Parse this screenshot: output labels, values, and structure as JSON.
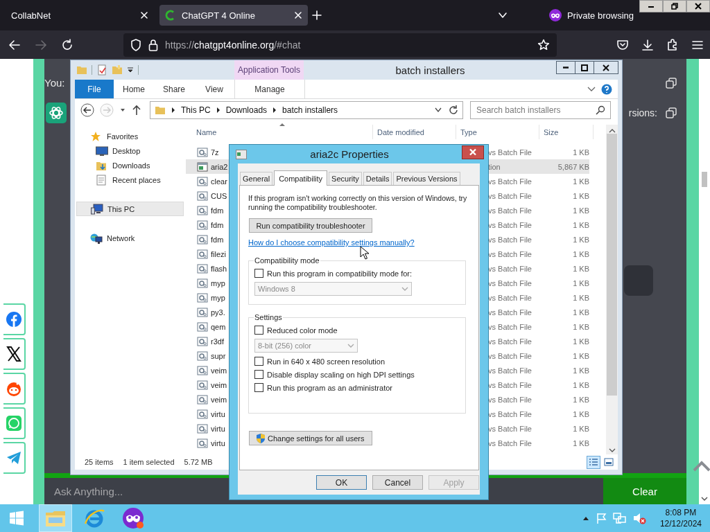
{
  "browser": {
    "tabs": [
      {
        "title": "CollabNet",
        "selected": false
      },
      {
        "title": "ChatGPT 4 Online",
        "selected": true
      }
    ],
    "private_label": "Private browsing",
    "url": {
      "scheme": "https://",
      "host": "chatgpt4online.org",
      "path": "/#chat"
    }
  },
  "webpage": {
    "chat_prefix": "You:",
    "answer_tail": "rsions:",
    "input": {
      "placeholder": "Ask Anything..."
    },
    "clear_button": "Clear",
    "share_links": [
      {
        "kind": "facebook"
      },
      {
        "kind": "x"
      },
      {
        "kind": "reddit"
      },
      {
        "kind": "whatsapp"
      },
      {
        "kind": "telegram"
      }
    ]
  },
  "explorer": {
    "title": "batch installers",
    "context_group": "Application Tools",
    "ribbon_tabs": [
      {
        "label": "File",
        "kind": "file"
      },
      {
        "label": "Home",
        "kind": "tab"
      },
      {
        "label": "Share",
        "kind": "tab"
      },
      {
        "label": "View",
        "kind": "tab"
      },
      {
        "label": "Manage",
        "kind": "context"
      }
    ],
    "breadcrumb": [
      "This PC",
      "Downloads",
      "batch installers"
    ],
    "search": {
      "placeholder": "Search batch installers"
    },
    "nav": [
      {
        "label": "Favorites",
        "kind": "star",
        "selected": false,
        "children": [
          {
            "label": "Desktop",
            "kind": "desktop",
            "selected": false
          },
          {
            "label": "Downloads",
            "kind": "downloads",
            "selected": false
          },
          {
            "label": "Recent places",
            "kind": "recent",
            "selected": false
          }
        ]
      },
      {
        "label": "This PC",
        "kind": "pc",
        "selected": true
      },
      {
        "label": "Network",
        "kind": "network",
        "selected": false
      }
    ],
    "columns": [
      "Name",
      "Date modified",
      "Type",
      "Size"
    ],
    "rows": [
      {
        "name": "7z",
        "type": "vs Batch File",
        "size": "1 KB",
        "kind": "batch",
        "selected": false
      },
      {
        "name": "aria2",
        "type": "tion",
        "size": "5,867 KB",
        "kind": "app",
        "selected": true
      },
      {
        "name": "clear",
        "type": "vs Batch File",
        "size": "1 KB",
        "kind": "batch",
        "selected": false
      },
      {
        "name": "CUS",
        "type": "vs Batch File",
        "size": "1 KB",
        "kind": "batch",
        "selected": false
      },
      {
        "name": "fdm",
        "type": "vs Batch File",
        "size": "1 KB",
        "kind": "batch",
        "selected": false
      },
      {
        "name": "fdm",
        "type": "vs Batch File",
        "size": "1 KB",
        "kind": "batch",
        "selected": false
      },
      {
        "name": "fdm",
        "type": "vs Batch File",
        "size": "1 KB",
        "kind": "batch",
        "selected": false
      },
      {
        "name": "filezi",
        "type": "vs Batch File",
        "size": "1 KB",
        "kind": "batch",
        "selected": false
      },
      {
        "name": "flash",
        "type": "vs Batch File",
        "size": "1 KB",
        "kind": "batch",
        "selected": false
      },
      {
        "name": "myp",
        "type": "vs Batch File",
        "size": "1 KB",
        "kind": "batch",
        "selected": false
      },
      {
        "name": "myp",
        "type": "vs Batch File",
        "size": "1 KB",
        "kind": "batch",
        "selected": false
      },
      {
        "name": "py3.",
        "type": "vs Batch File",
        "size": "1 KB",
        "kind": "batch",
        "selected": false
      },
      {
        "name": "qem",
        "type": "vs Batch File",
        "size": "1 KB",
        "kind": "batch",
        "selected": false
      },
      {
        "name": "r3df",
        "type": "vs Batch File",
        "size": "1 KB",
        "kind": "batch",
        "selected": false
      },
      {
        "name": "supr",
        "type": "vs Batch File",
        "size": "1 KB",
        "kind": "batch",
        "selected": false
      },
      {
        "name": "veim",
        "type": "vs Batch File",
        "size": "1 KB",
        "kind": "batch",
        "selected": false
      },
      {
        "name": "veim",
        "type": "vs Batch File",
        "size": "1 KB",
        "kind": "batch",
        "selected": false
      },
      {
        "name": "veim",
        "type": "vs Batch File",
        "size": "1 KB",
        "kind": "batch",
        "selected": false
      },
      {
        "name": "virtu",
        "type": "vs Batch File",
        "size": "1 KB",
        "kind": "batch",
        "selected": false
      },
      {
        "name": "virtu",
        "type": "vs Batch File",
        "size": "1 KB",
        "kind": "batch",
        "selected": false
      },
      {
        "name": "virtu",
        "type": "vs Batch File",
        "size": "1 KB",
        "kind": "batch",
        "selected": false
      }
    ],
    "status": {
      "count": "25 items",
      "selection": "1 item selected",
      "size": "5.72 MB"
    }
  },
  "dialog": {
    "title": "aria2c Properties",
    "tabs": [
      {
        "label": "General",
        "selected": false
      },
      {
        "label": "Compatibility",
        "selected": true
      },
      {
        "label": "Security",
        "selected": false
      },
      {
        "label": "Details",
        "selected": false
      },
      {
        "label": "Previous Versions",
        "selected": false
      }
    ],
    "intro": "If this program isn't working correctly on this version of Windows, try running the compatibility troubleshooter.",
    "troubleshooter_button": "Run compatibility troubleshooter",
    "help_link": "How do I choose compatibility settings manually?",
    "groups": [
      {
        "title": "Compatibility mode",
        "items": [
          {
            "kind": "checkbox",
            "label": "Run this program in compatibility mode for:",
            "checked": false
          },
          {
            "kind": "select",
            "value": "Windows 8",
            "disabled": true
          }
        ]
      },
      {
        "title": "Settings",
        "items": [
          {
            "kind": "checkbox",
            "label": "Reduced color mode",
            "checked": false
          },
          {
            "kind": "select",
            "value": "8-bit (256) color",
            "disabled": true
          },
          {
            "kind": "checkbox",
            "label": "Run in 640 x 480 screen resolution",
            "checked": false
          },
          {
            "kind": "checkbox",
            "label": "Disable display scaling on high DPI settings",
            "checked": false
          },
          {
            "kind": "checkbox",
            "label": "Run this program as an administrator",
            "checked": false
          }
        ]
      }
    ],
    "all_users_button": "Change settings for all users",
    "buttons": [
      {
        "label": "OK",
        "disabled": false
      },
      {
        "label": "Cancel",
        "disabled": false
      },
      {
        "label": "Apply",
        "disabled": true
      }
    ]
  },
  "taskbar": {
    "apps": [
      {
        "kind": "explorer",
        "selected": true
      },
      {
        "kind": "ie",
        "selected": false
      },
      {
        "kind": "private",
        "selected": false
      }
    ],
    "time": "8:08 PM",
    "date": "12/12/2024"
  }
}
